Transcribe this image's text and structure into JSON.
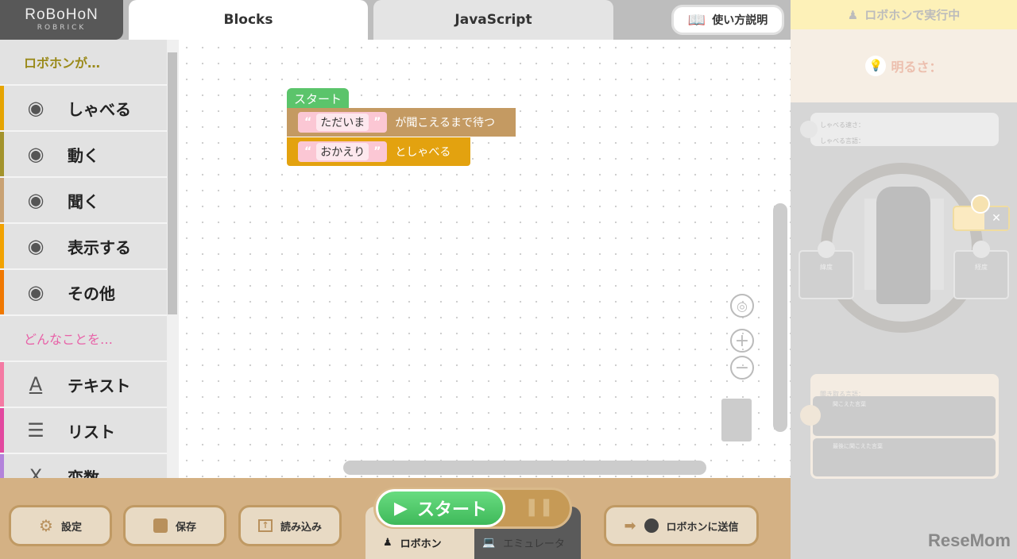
{
  "logo": {
    "title": "RoBoHoN",
    "subtitle": "ROBRICK"
  },
  "tabs": [
    {
      "label": "Blocks"
    },
    {
      "label": "JavaScript"
    }
  ],
  "help_button": "使い方説明",
  "sidebar": {
    "header1": "ロボホンが…",
    "header2": "どんなことを…",
    "items": [
      {
        "label": "しゃべる",
        "color": "#e6a400"
      },
      {
        "label": "動く",
        "color": "#a3932c"
      },
      {
        "label": "聞く",
        "color": "#c9a274"
      },
      {
        "label": "表示する",
        "color": "#f2a200"
      },
      {
        "label": "その他",
        "color": "#f07800"
      },
      {
        "label": "テキスト",
        "color": "#f47aa3"
      },
      {
        "label": "リスト",
        "color": "#e2489f"
      },
      {
        "label": "変数",
        "color": "#b383db"
      }
    ]
  },
  "blocks": {
    "start": "スタート",
    "wait": {
      "text": "ただいま",
      "suffix": "が聞こえるまで待つ"
    },
    "say": {
      "text": "おかえり",
      "suffix": "としゃべる"
    },
    "open_quote": "“",
    "close_quote": "”"
  },
  "bottom": {
    "settings": "設定",
    "save": "保存",
    "load": "読み込み",
    "start": "スタート",
    "mode_robohon": "ロボホン",
    "mode_emulator": "エミュレータ",
    "send": "ロボホンに送信"
  },
  "right": {
    "running": "ロボホンで実行中",
    "brightness": "明るさ：",
    "speak_speed": "しゃべる速さ：",
    "speak_lang": "しゃべる言語：",
    "latitude": "緯度",
    "longitude": "経度",
    "listen_lang": "聞き取る言語：",
    "heard": "聞こえた言葉",
    "last_heard": "最後に聞こえた言葉"
  },
  "watermark": "ReseMom"
}
